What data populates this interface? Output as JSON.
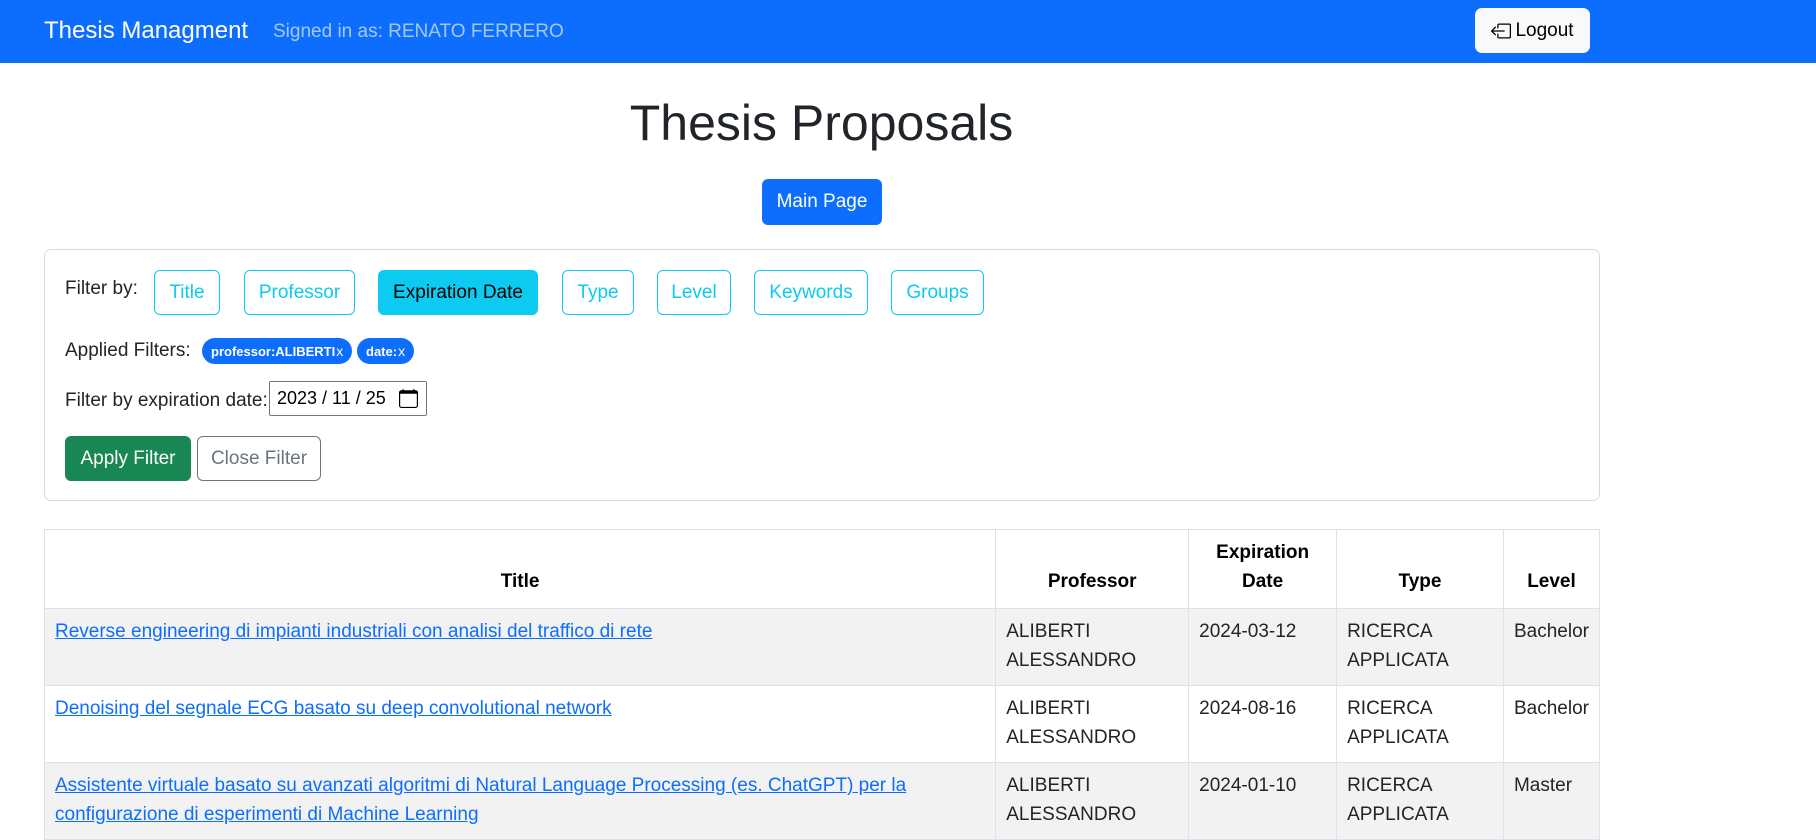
{
  "navbar": {
    "brand": "Thesis Managment",
    "signed_in": "Signed in as: RENATO FERRERO",
    "logout_label": "Logout"
  },
  "page": {
    "title": "Thesis Proposals",
    "main_page_label": "Main Page"
  },
  "filters": {
    "filter_by_label": "Filter by:",
    "buttons": [
      "Title",
      "Professor",
      "Expiration Date",
      "Type",
      "Level",
      "Keywords",
      "Groups"
    ],
    "active": "Expiration Date",
    "applied_label": "Applied Filters:",
    "chips": [
      {
        "label": "professor:ALIBERTI",
        "remove": "x"
      },
      {
        "label": "date:",
        "remove": "x"
      }
    ],
    "date_label": "Filter by expiration date:",
    "date_value": "2023 / 11 / 25",
    "apply_label": "Apply Filter",
    "close_label": "Close Filter"
  },
  "table": {
    "headers": [
      "Title",
      "Professor",
      "Expiration Date",
      "Type",
      "Level"
    ],
    "rows": [
      {
        "title": "Reverse engineering di impianti industriali con analisi del traffico di rete",
        "professor": "ALIBERTI ALESSANDRO",
        "expiration": "2024-03-12",
        "type": "RICERCA APPLICATA",
        "level": "Bachelor"
      },
      {
        "title": "Denoising del segnale ECG basato su deep convolutional network",
        "professor": "ALIBERTI ALESSANDRO",
        "expiration": "2024-08-16",
        "type": "RICERCA APPLICATA",
        "level": "Bachelor"
      },
      {
        "title": "Assistente virtuale basato su avanzati algoritmi di Natural Language Processing (es. ChatGPT) per la configurazione di esperimenti di Machine Learning",
        "professor": "ALIBERTI ALESSANDRO",
        "expiration": "2024-01-10",
        "type": "RICERCA APPLICATA",
        "level": "Master"
      }
    ]
  },
  "colors": {
    "primary": "#0d6efd",
    "info": "#0dcaf0",
    "success": "#198754",
    "secondary": "#6c757d"
  },
  "icons": {
    "logout": "box-arrow-left-icon",
    "calendar": "calendar-icon"
  }
}
